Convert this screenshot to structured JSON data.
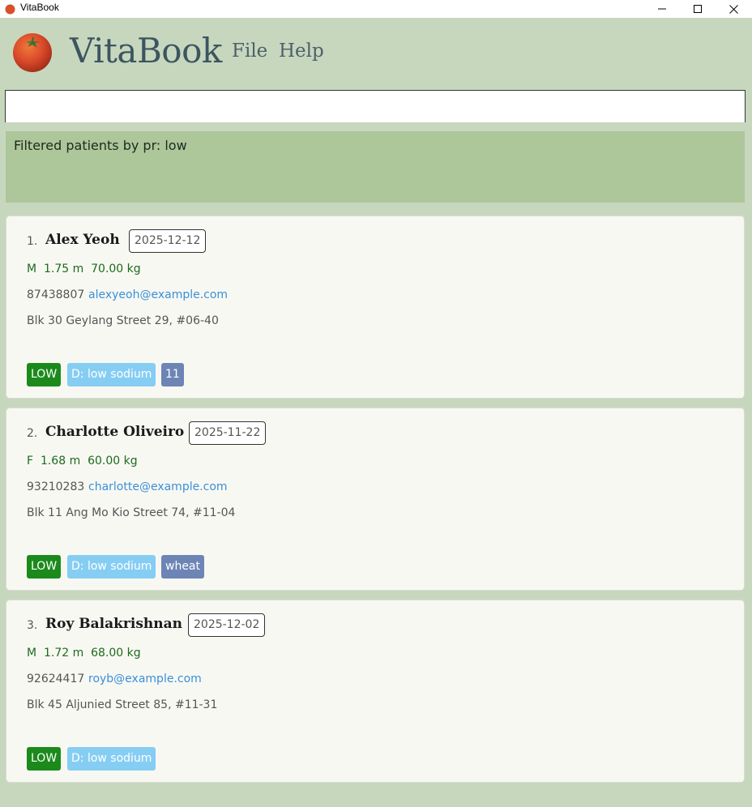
{
  "window": {
    "title": "VitaBook",
    "controls": [
      "minimize",
      "maximize",
      "close"
    ]
  },
  "header": {
    "app_name": "VitaBook",
    "menu": [
      {
        "label": "File"
      },
      {
        "label": "Help"
      }
    ]
  },
  "command_box": {
    "value": "",
    "placeholder": ""
  },
  "result": {
    "message": "Filtered patients by pr: low"
  },
  "patients": [
    {
      "index": "1.",
      "name": "Alex Yeoh",
      "date": "2025-12-12",
      "vitals": "M  1.75 m  70.00 kg",
      "phone": "87438807",
      "email": "alexyeoh@example.com",
      "address": "Blk 30 Geylang Street 29, #06-40",
      "priority": "LOW",
      "diet": "D: low sodium",
      "tag": "11"
    },
    {
      "index": "2.",
      "name": "Charlotte Oliveiro",
      "date": "2025-11-22",
      "vitals": "F  1.68 m  60.00 kg",
      "phone": "93210283",
      "email": "charlotte@example.com",
      "address": "Blk 11 Ang Mo Kio Street 74, #11-04",
      "priority": "LOW",
      "diet": "D: low sodium",
      "tag": "wheat"
    },
    {
      "index": "3.",
      "name": "Roy Balakrishnan",
      "date": "2025-12-02",
      "vitals": "M  1.72 m  68.00 kg",
      "phone": "92624417",
      "email": "royb@example.com",
      "address": "Blk 45 Aljunied Street 85, #11-31",
      "priority": "LOW",
      "diet": "D: low sodium",
      "tag": ""
    }
  ],
  "colors": {
    "background": "#c7d7be",
    "result_bg": "#adc69a",
    "card_bg": "#f8f8f3",
    "priority_tag": "#1b8a1b",
    "diet_tag": "#86cdf4",
    "other_tag": "#6d85b5",
    "email": "#3a90d9",
    "vitals": "#1c6b1c"
  },
  "icons": {
    "app": "tomato-icon",
    "minimize": "minimize-icon",
    "maximize": "maximize-icon",
    "close": "close-icon"
  }
}
